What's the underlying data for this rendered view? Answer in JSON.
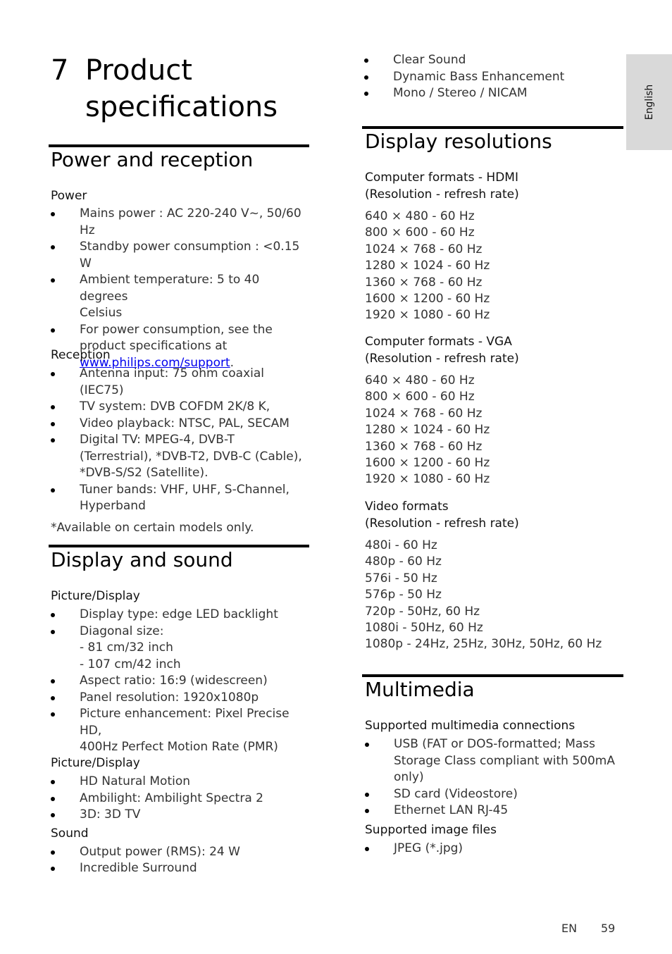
{
  "chapter": {
    "number": "7",
    "title_line1": "Product",
    "title_line2": "specifications"
  },
  "side_tab": {
    "label": "English"
  },
  "sections": {
    "power_reception": {
      "title": "Power and reception",
      "power": {
        "heading": "Power",
        "items": [
          [
            "Mains power : AC 220-240 V~, 50/60",
            "Hz"
          ],
          [
            "Standby power consumption : <0.15 W"
          ],
          [
            "Ambient temperature: 5 to 40 degrees",
            "Celsius"
          ],
          [
            "For power consumption, see the",
            "product specifications at"
          ]
        ],
        "link_text": "www.philips.com/support",
        "link_suffix": "."
      },
      "reception": {
        "heading": "Reception",
        "items": [
          [
            "Antenna input: 75 ohm coaxial (IEC75)"
          ],
          [
            "TV system: DVB COFDM 2K/8 K,"
          ],
          [
            "Video playback: NTSC, PAL, SECAM"
          ],
          [
            "Digital TV: MPEG-4, DVB-T",
            "(Terrestrial), *DVB-T2, DVB-C (Cable),",
            "*DVB-S/S2 (Satellite)."
          ],
          [
            "Tuner bands: VHF, UHF, S-Channel,",
            "Hyperband"
          ]
        ],
        "footnote": "*Available on certain models only."
      }
    },
    "display_sound": {
      "title": "Display and sound",
      "picture1": {
        "heading": "Picture/Display",
        "items": [
          [
            "Display type: edge LED backlight"
          ],
          [
            "Diagonal size:",
            "- 81 cm/32 inch",
            "- 107 cm/42 inch"
          ],
          [
            "Aspect ratio: 16:9 (widescreen)"
          ],
          [
            "Panel resolution: 1920x1080p"
          ],
          [
            "Picture enhancement: Pixel Precise HD,",
            "400Hz Perfect Motion Rate (PMR)"
          ]
        ]
      },
      "picture2": {
        "heading": "Picture/Display",
        "items": [
          [
            "HD Natural Motion"
          ],
          [
            "Ambilight: Ambilight Spectra 2"
          ],
          [
            "3D: 3D TV"
          ]
        ]
      },
      "sound": {
        "heading": "Sound",
        "items": [
          [
            "Output power (RMS): 24 W"
          ],
          [
            "Incredible Surround"
          ],
          [
            "Clear Sound"
          ],
          [
            "Dynamic Bass Enhancement"
          ],
          [
            "Mono / Stereo / NICAM"
          ]
        ]
      }
    },
    "display_resolutions": {
      "title": "Display resolutions",
      "hdmi": {
        "heading_line1": "Computer formats - HDMI",
        "heading_line2": "(Resolution - refresh rate)",
        "rows": [
          "640 × 480 - 60 Hz",
          "800 × 600 - 60 Hz",
          "1024 × 768 - 60 Hz",
          "1280 × 1024 - 60 Hz",
          "1360 × 768 - 60 Hz",
          "1600 × 1200 - 60 Hz",
          "1920 × 1080 - 60 Hz"
        ]
      },
      "vga": {
        "heading_line1": "Computer formats - VGA",
        "heading_line2": "(Resolution - refresh rate)",
        "rows": [
          "640 × 480 - 60 Hz",
          "800 × 600 - 60 Hz",
          "1024 × 768 - 60 Hz",
          "1280 × 1024 - 60 Hz",
          "1360 × 768 - 60 Hz",
          "1600 × 1200 - 60 Hz",
          "1920 × 1080 - 60 Hz"
        ]
      },
      "video": {
        "heading_line1": "Video formats",
        "heading_line2": "(Resolution - refresh rate)",
        "rows": [
          "480i - 60 Hz",
          "480p - 60 Hz",
          "576i - 50 Hz",
          "576p - 50 Hz",
          "720p - 50Hz, 60 Hz",
          "1080i - 50Hz, 60 Hz",
          "1080p - 24Hz, 25Hz, 30Hz, 50Hz, 60 Hz"
        ]
      }
    },
    "multimedia": {
      "title": "Multimedia",
      "connections": {
        "heading": "Supported multimedia connections",
        "items": [
          [
            "USB (FAT or DOS-formatted; Mass",
            "Storage Class compliant with 500mA",
            "only)"
          ],
          [
            "SD card (Videostore)"
          ],
          [
            "Ethernet LAN RJ-45"
          ]
        ]
      },
      "images": {
        "heading": "Supported image files",
        "items": [
          [
            "JPEG (*.jpg)"
          ]
        ]
      }
    }
  },
  "footer": {
    "lang": "EN",
    "page": "59"
  }
}
